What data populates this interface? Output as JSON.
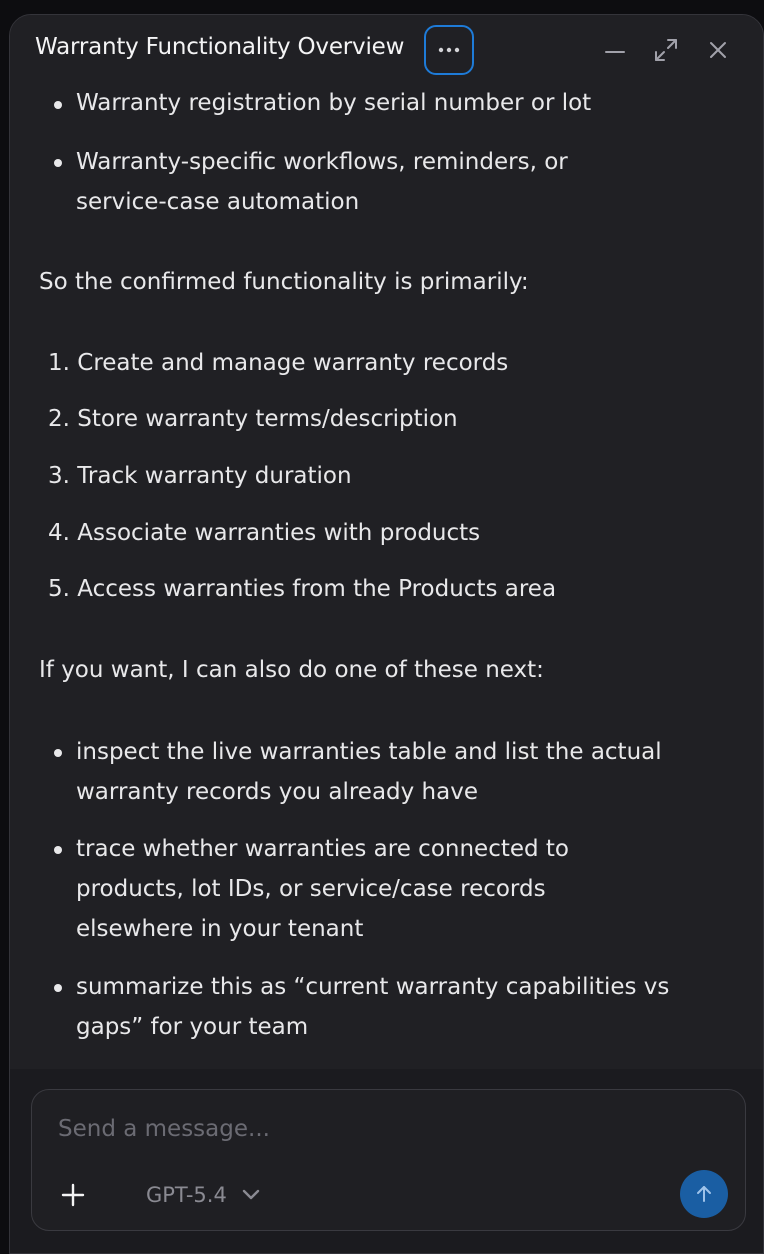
{
  "window": {
    "title": "Warranty Functionality Overview"
  },
  "message": {
    "partial_bullet": "Warranty registration by serial number or lot",
    "bullets_top": [
      "Warranty-specific workflows, reminders, or service-case automation"
    ],
    "summary_intro": "So the confirmed functionality is primarily:",
    "numbered": [
      {
        "num": "1.",
        "text": "Create and manage warranty records"
      },
      {
        "num": "2.",
        "text": "Store warranty terms/description"
      },
      {
        "num": "3.",
        "text": "Track warranty duration"
      },
      {
        "num": "4.",
        "text": "Associate warranties with products"
      },
      {
        "num": "5.",
        "text": "Access warranties from the Products area"
      }
    ],
    "next_intro": "If you want, I can also do one of these next:",
    "bullets_next": [
      "inspect the live warranties table and list the actual warranty records you already have",
      "trace whether warranties are connected to products, lot IDs, or service/case records elsewhere in your tenant",
      "summarize this as “current warranty capabilities vs gaps” for your team"
    ]
  },
  "composer": {
    "placeholder": "Send a message...",
    "model": "GPT-5.4"
  },
  "icons": {
    "more": "more-horizontal-icon",
    "minimize": "minimize-icon",
    "expand": "expand-icon",
    "close": "close-icon",
    "add": "plus-icon",
    "model_chevron": "chevron-down-icon",
    "send": "arrow-up-icon"
  },
  "colors": {
    "accent": "#1e7bd8",
    "send_button": "#1a5ea3",
    "panel_bg": "#202024"
  }
}
